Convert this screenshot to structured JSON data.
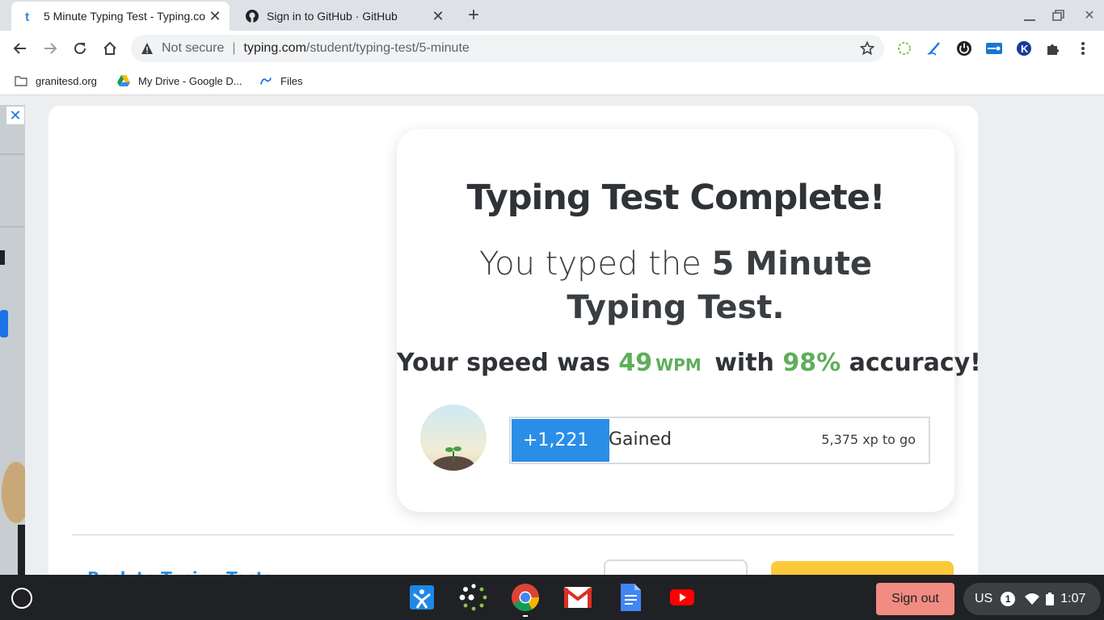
{
  "tabs": [
    {
      "title": "5 Minute Typing Test - Typing.com",
      "favicon": "typing-t-icon",
      "active": true
    },
    {
      "title": "Sign in to GitHub · GitHub",
      "favicon": "github-icon",
      "active": false
    }
  ],
  "omnibox": {
    "security": "Not secure",
    "host": "typing.com",
    "path": "/student/typing-test/5-minute"
  },
  "bookmarks": [
    {
      "label": "granitesd.org",
      "icon": "folder-icon"
    },
    {
      "label": "My Drive - Google D...",
      "icon": "google-drive-icon"
    },
    {
      "label": "Files",
      "icon": "files-icon"
    }
  ],
  "result": {
    "title": "Typing Test Complete!",
    "typed_prefix": "You typed the ",
    "test_name": "5 Minute Typing Test.",
    "speed_prefix": "Your speed was ",
    "wpm_value": "49",
    "wpm_unit": "WPM",
    "speed_mid": " with ",
    "accuracy": "98%",
    "speed_suffix": " accuracy!",
    "xp_gained": "+1,221 XP",
    "xp_gained_label": "Gained",
    "xp_to_go": "5,375 xp to go",
    "xp_progress_fraction": 0.235
  },
  "footer": {
    "back_link": "Back to Typing Tests"
  },
  "shelf": {
    "apps": [
      "xodo-icon",
      "loading-dots-icon",
      "chrome-icon",
      "gmail-icon",
      "google-docs-icon",
      "youtube-icon"
    ],
    "sign_out": "Sign out",
    "keyboard": "US",
    "notifications": "1",
    "time": "1:07"
  },
  "colors": {
    "accent_blue": "#2a8ee6",
    "success_green": "#5fae5a",
    "signout_red": "#f28b82",
    "cta_yellow": "#fcc93a"
  }
}
